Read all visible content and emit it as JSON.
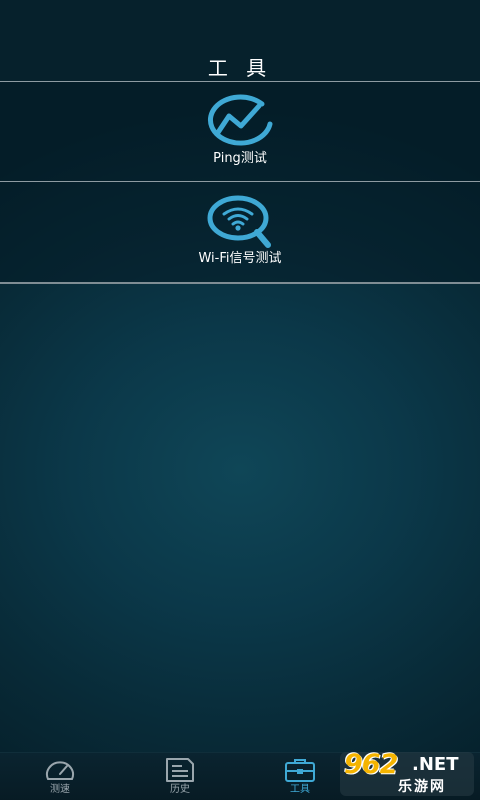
{
  "header": {
    "title": "工 具"
  },
  "tools": [
    {
      "label": "Ping测试",
      "icon": "ping-chart-icon"
    },
    {
      "label": "Wi-Fi信号测试",
      "icon": "wifi-search-icon"
    }
  ],
  "tabbar": {
    "tabs": [
      {
        "label": "测速",
        "icon": "speedometer-icon",
        "active": false
      },
      {
        "label": "历史",
        "icon": "document-icon",
        "active": false
      },
      {
        "label": "工具",
        "icon": "toolbox-icon",
        "active": true
      },
      {
        "label": "",
        "icon": "",
        "active": false
      }
    ]
  },
  "watermark": {
    "logo": "962",
    "suffix": ".NET",
    "text": "乐游网"
  },
  "colors": {
    "accent": "#3fa9d5",
    "background": "#0b3849",
    "divider": "#8e9ba2"
  }
}
